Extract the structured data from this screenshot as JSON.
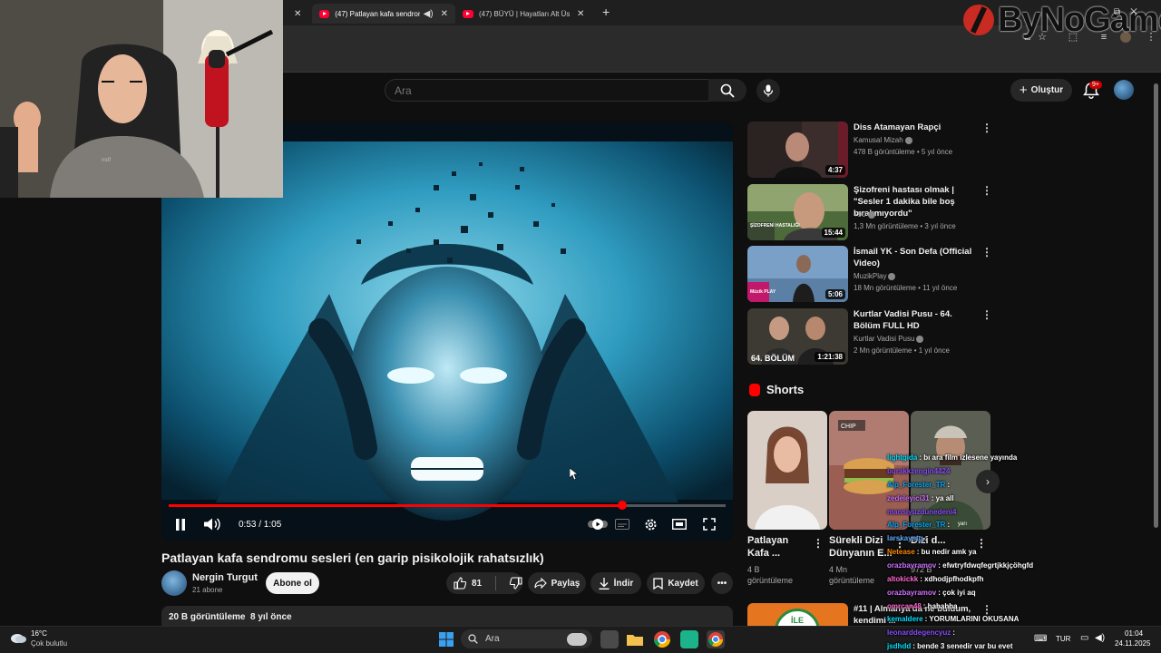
{
  "browser": {
    "tabs": [
      {
        "label": "(47) Patlayan kafa sendrom",
        "active": true
      },
      {
        "label": "(47) BÜYÜ | Hayatları Alt Üst Ed",
        "active": false
      }
    ],
    "new_tab_symbol": "+"
  },
  "brand": {
    "text": "ByNoGame",
    "color": "#c92a22"
  },
  "header": {
    "search_placeholder": "Ara",
    "create_label": "Oluştur",
    "notification_count": "9+"
  },
  "player": {
    "time_display": "0:53 / 1:05",
    "progress": 0.815,
    "accent_color": "#ff0000"
  },
  "video": {
    "title": "Patlayan kafa sendromu sesleri (en garip pisikolojik rahatsızlık)",
    "channel": "Nergin Turgut",
    "subscribers": "21 abone",
    "subscribe_label": "Abone ol",
    "likes": "81",
    "share_label": "Paylaş",
    "download_label": "İndir",
    "save_label": "Kaydet",
    "views": "20 B görüntüleme",
    "age": "8 yıl önce"
  },
  "recommendations": [
    {
      "title": "Diss Atamayan Rapçi",
      "channel": "Kamusal Mizah",
      "meta": "478 B görüntüleme • 5 yıl önce",
      "duration": "4:37"
    },
    {
      "title": "Şizofreni hastası olmak | \"Sesler 1 dakika bile boş bırakmıyordu\"",
      "channel": "+90",
      "meta": "1,3 Mn görüntüleme • 3 yıl önce",
      "duration": "15:44"
    },
    {
      "title": "İsmail YK - Son Defa (Official Video)",
      "channel": "MuzikPlay",
      "meta": "18 Mn görüntüleme • 11 yıl önce",
      "duration": "5:06"
    },
    {
      "title": "Kurtlar Vadisi Pusu - 64. Bölüm FULL HD",
      "channel": "Kurtlar Vadisi Pusu",
      "meta": "2 Mn görüntüleme • 1 yıl önce",
      "duration": "1:21:38"
    }
  ],
  "shorts": {
    "heading": "Shorts",
    "items": [
      {
        "title": "Patlayan Kafa ...",
        "views": "4 B görüntüleme"
      },
      {
        "title": "Sürekli Dizi Dünyanın E...",
        "views": "4 Mn görüntüleme"
      },
      {
        "title": "Dizi d...",
        "views": "972 B"
      }
    ]
  },
  "thumb_text": {
    "schizo": "ŞİZOFRENİ HASTALIĞI",
    "music": "Müzik PLAY",
    "episode": "64. BÖLÜM",
    "shorts1": "CHIP",
    "shorts3": "yarı"
  },
  "webcam_label": "mdf",
  "next_video": {
    "title": "#11 | Almanya'da ne buldum, kendimi ...",
    "badge": "İLE"
  },
  "chat": [
    {
      "user": "lightgida",
      "msg": ": bı ara film izlesene yayında",
      "color": "#00e0ff"
    },
    {
      "user": "burakkzengin4424",
      "msg": "",
      "color": "#8a4dff"
    },
    {
      "user": "Alp_Forester_TR",
      "msg": ":",
      "color": "#00a8ff"
    },
    {
      "user": "zedeleyici31",
      "msg": ": ya all",
      "color": "#d070ff"
    },
    {
      "user": "mansiyuzdunedeni4",
      "msg": "",
      "color": "#8a4dff"
    },
    {
      "user": "Alp_Forester_TR",
      "msg": ":",
      "color": "#00a8ff"
    },
    {
      "user": "larskaystg",
      "msg": ":",
      "color": "#5fa8ff"
    },
    {
      "user": "Netease",
      "msg": ": bu nedir amk ya",
      "color": "#ff8800"
    },
    {
      "user": "orazbayramov",
      "msg": ": efwtryfdwqfegrtjkkjçöhgfd",
      "color": "#d070ff"
    },
    {
      "user": "altokickk",
      "msg": ": xdhodjpfhodkpfh",
      "color": "#ff66cc"
    },
    {
      "user": "orazbayramov",
      "msg": ": çok iyi aq",
      "color": "#d070ff"
    },
    {
      "user": "omrcan48",
      "msg": ": hahahha",
      "color": "#ff66cc"
    },
    {
      "user": "kemaldere",
      "msg": ": YORUMLARINI OKUSANA",
      "color": "#00e0ff"
    },
    {
      "user": "leonarddegencyuz",
      "msg": ":",
      "color": "#8a4dff"
    },
    {
      "user": "jsdhdd",
      "msg": ": bende 3 senedir var bu evet",
      "color": "#00e0ff"
    }
  ],
  "taskbar": {
    "temp": "16°C",
    "weather": "Çok bulutlu",
    "search_placeholder": "Ara",
    "language": "TUR",
    "time": "01:04",
    "date": "24.11.2025"
  }
}
